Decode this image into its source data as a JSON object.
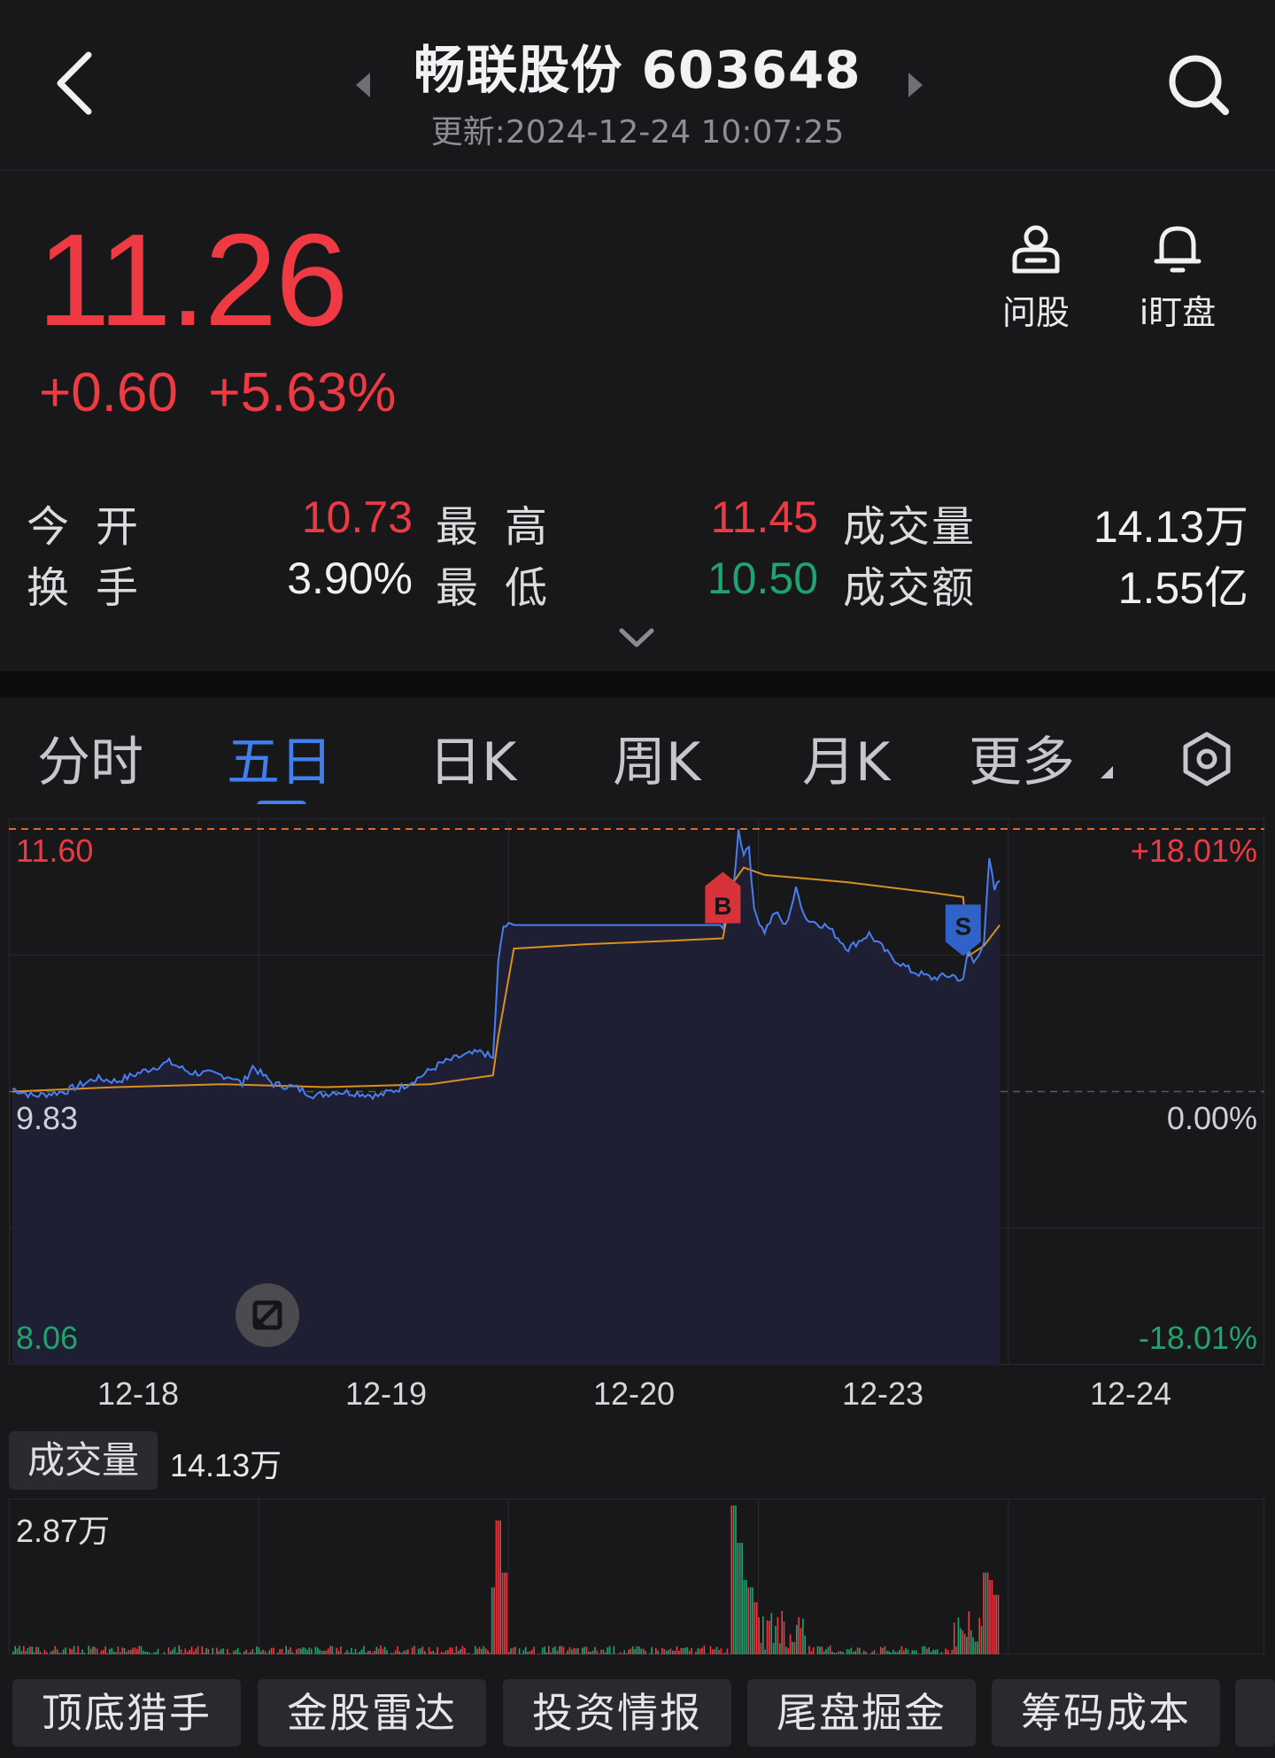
{
  "header": {
    "title": "畅联股份 603648",
    "subtitle": "更新:2024-12-24 10:07:25"
  },
  "quote": {
    "price": "11.26",
    "change": "+0.60",
    "change_pct": "+5.63%",
    "price_color": "#ef3a43"
  },
  "actions": {
    "ask": "问股",
    "watch": "i盯盘"
  },
  "stats": {
    "open_label": "今开",
    "open": "10.73",
    "high_label": "最高",
    "high": "11.45",
    "volume_label": "成交量",
    "volume": "14.13万",
    "turnover_label": "换手",
    "turnover": "3.90%",
    "low_label": "最低",
    "low": "10.50",
    "amount_label": "成交额",
    "amount": "1.55亿"
  },
  "tabs": [
    "分时",
    "五日",
    "日K",
    "周K",
    "月K",
    "更多"
  ],
  "active_tab": "五日",
  "chart": {
    "y_left_top": "11.60",
    "y_left_mid": "9.83",
    "y_left_bottom": "8.06",
    "y_right_top": "+18.01%",
    "y_right_mid": "0.00%",
    "y_right_bottom": "-18.01%",
    "dates": [
      "12-18",
      "12-19",
      "12-20",
      "12-23",
      "12-24"
    ],
    "buy_marker": "B",
    "sell_marker": "S",
    "up_color": "#ef3a43",
    "down_color": "#1fa46f",
    "line_color": "#4a7ef0",
    "avg_color": "#d9901f"
  },
  "volume": {
    "label": "成交量",
    "value": "14.13万",
    "max": "2.87万"
  },
  "tools": [
    "顶底猎手",
    "金股雷达",
    "投资情报",
    "尾盘掘金",
    "筹码成本"
  ],
  "chart_data": {
    "type": "line",
    "x": [
      "12-18",
      "12-19",
      "12-20",
      "12-23",
      "12-24"
    ],
    "series": [],
    "ylim": [
      8.06,
      11.6
    ],
    "yref": 9.83,
    "points": [
      [
        0.0,
        9.85
      ],
      [
        0.02,
        9.8
      ],
      [
        0.05,
        9.83
      ],
      [
        0.08,
        9.92
      ],
      [
        0.1,
        9.9
      ],
      [
        0.13,
        9.98
      ],
      [
        0.15,
        10.03
      ],
      [
        0.17,
        9.96
      ],
      [
        0.19,
        9.95
      ],
      [
        0.21,
        9.93
      ],
      [
        0.22,
        9.88
      ],
      [
        0.23,
        10.0
      ],
      [
        0.25,
        9.88
      ],
      [
        0.27,
        9.86
      ],
      [
        0.29,
        9.8
      ],
      [
        0.31,
        9.83
      ],
      [
        0.33,
        9.82
      ],
      [
        0.35,
        9.8
      ],
      [
        0.37,
        9.85
      ],
      [
        0.39,
        9.93
      ],
      [
        0.41,
        10.02
      ],
      [
        0.43,
        10.07
      ],
      [
        0.45,
        10.1
      ],
      [
        0.46,
        10.05
      ],
      [
        0.465,
        10.7
      ],
      [
        0.47,
        10.95
      ],
      [
        0.48,
        10.96
      ],
      [
        0.5,
        10.96
      ],
      [
        0.55,
        10.96
      ],
      [
        0.6,
        10.96
      ],
      [
        0.65,
        10.96
      ],
      [
        0.68,
        10.96
      ],
      [
        0.69,
        11.2
      ],
      [
        0.695,
        11.6
      ],
      [
        0.7,
        11.45
      ],
      [
        0.705,
        11.5
      ],
      [
        0.71,
        11.05
      ],
      [
        0.72,
        10.92
      ],
      [
        0.73,
        11.05
      ],
      [
        0.74,
        10.95
      ],
      [
        0.75,
        11.2
      ],
      [
        0.76,
        11.0
      ],
      [
        0.78,
        10.95
      ],
      [
        0.8,
        10.8
      ],
      [
        0.82,
        10.9
      ],
      [
        0.84,
        10.75
      ],
      [
        0.86,
        10.65
      ],
      [
        0.88,
        10.6
      ],
      [
        0.9,
        10.62
      ],
      [
        0.91,
        10.58
      ],
      [
        0.915,
        10.8
      ],
      [
        0.92,
        10.7
      ],
      [
        0.93,
        10.85
      ],
      [
        0.935,
        11.4
      ],
      [
        0.94,
        11.2
      ],
      [
        0.945,
        11.26
      ]
    ],
    "avg": [
      [
        0.0,
        9.83
      ],
      [
        0.1,
        9.86
      ],
      [
        0.2,
        9.88
      ],
      [
        0.3,
        9.86
      ],
      [
        0.4,
        9.88
      ],
      [
        0.46,
        9.94
      ],
      [
        0.465,
        10.2
      ],
      [
        0.48,
        10.8
      ],
      [
        0.55,
        10.83
      ],
      [
        0.62,
        10.85
      ],
      [
        0.68,
        10.87
      ],
      [
        0.69,
        11.25
      ],
      [
        0.7,
        11.35
      ],
      [
        0.72,
        11.3
      ],
      [
        0.8,
        11.25
      ],
      [
        0.88,
        11.18
      ],
      [
        0.91,
        11.15
      ],
      [
        0.915,
        10.75
      ],
      [
        0.93,
        10.82
      ],
      [
        0.945,
        10.96
      ]
    ]
  }
}
